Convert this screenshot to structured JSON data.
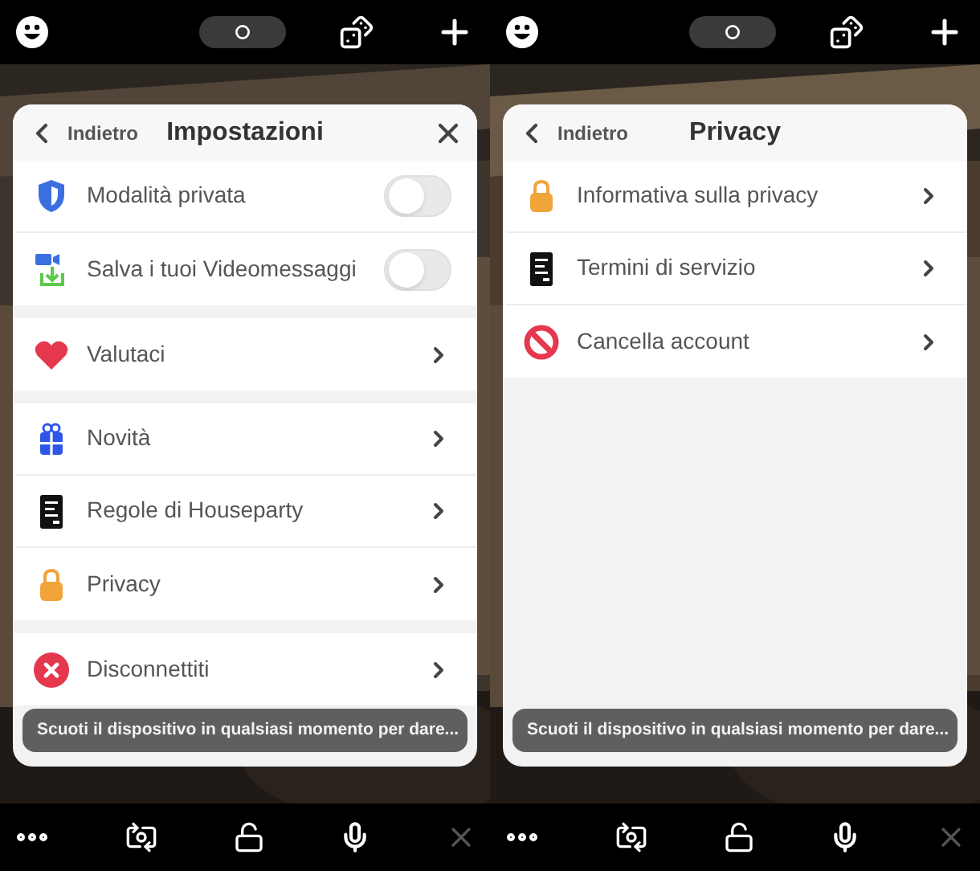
{
  "screens": [
    {
      "panel": {
        "back": "Indietro",
        "title": "Impostazioni",
        "close": true,
        "sections": [
          [
            {
              "kind": "toggle",
              "label": "Modalità privata",
              "on": false
            },
            {
              "kind": "toggle",
              "label": "Salva i tuoi Videomessaggi",
              "on": false
            }
          ],
          [
            {
              "kind": "link",
              "label": "Valutaci"
            }
          ],
          [
            {
              "kind": "link",
              "label": "Novità"
            },
            {
              "kind": "link",
              "label": "Regole di Houseparty"
            },
            {
              "kind": "link",
              "label": "Privacy"
            }
          ],
          [
            {
              "kind": "link",
              "label": "Disconnettiti"
            }
          ]
        ]
      },
      "toast": "Scuoti il dispositivo in qualsiasi momento per dare...",
      "bottom_bar": {
        "end_call_disabled": true
      }
    },
    {
      "panel": {
        "back": "Indietro",
        "title": "Privacy",
        "close": false,
        "sections": [
          [
            {
              "kind": "link",
              "label": "Informativa sulla privacy"
            },
            {
              "kind": "link",
              "label": "Termini di servizio"
            },
            {
              "kind": "link",
              "label": "Cancella account"
            }
          ]
        ]
      },
      "toast": "Scuoti il dispositivo in qualsiasi momento per dare...",
      "bottom_bar": {
        "end_call_disabled": true
      }
    }
  ]
}
